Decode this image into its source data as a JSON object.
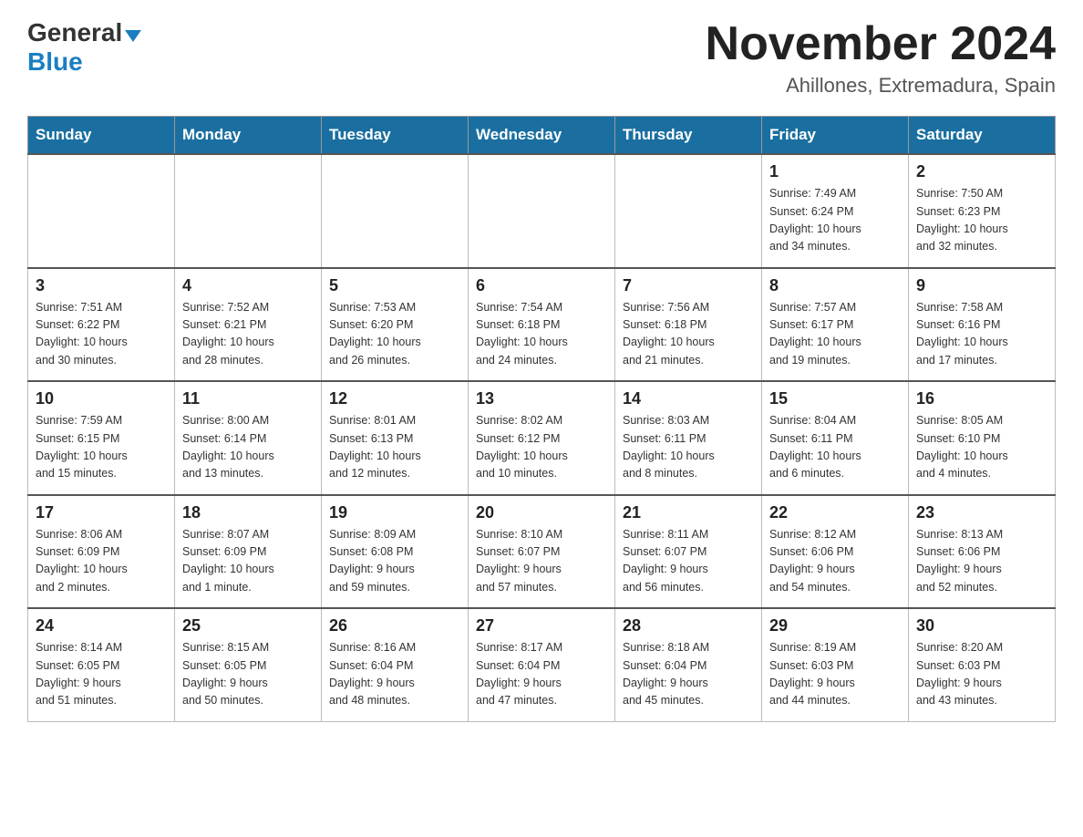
{
  "logo": {
    "general": "General",
    "blue": "Blue",
    "triangle": "▼"
  },
  "title": "November 2024",
  "location": "Ahillones, Extremadura, Spain",
  "days_of_week": [
    "Sunday",
    "Monday",
    "Tuesday",
    "Wednesday",
    "Thursday",
    "Friday",
    "Saturday"
  ],
  "weeks": [
    {
      "days": [
        {
          "number": "",
          "info": "",
          "empty": true
        },
        {
          "number": "",
          "info": "",
          "empty": true
        },
        {
          "number": "",
          "info": "",
          "empty": true
        },
        {
          "number": "",
          "info": "",
          "empty": true
        },
        {
          "number": "",
          "info": "",
          "empty": true
        },
        {
          "number": "1",
          "info": "Sunrise: 7:49 AM\nSunset: 6:24 PM\nDaylight: 10 hours\nand 34 minutes."
        },
        {
          "number": "2",
          "info": "Sunrise: 7:50 AM\nSunset: 6:23 PM\nDaylight: 10 hours\nand 32 minutes."
        }
      ]
    },
    {
      "days": [
        {
          "number": "3",
          "info": "Sunrise: 7:51 AM\nSunset: 6:22 PM\nDaylight: 10 hours\nand 30 minutes."
        },
        {
          "number": "4",
          "info": "Sunrise: 7:52 AM\nSunset: 6:21 PM\nDaylight: 10 hours\nand 28 minutes."
        },
        {
          "number": "5",
          "info": "Sunrise: 7:53 AM\nSunset: 6:20 PM\nDaylight: 10 hours\nand 26 minutes."
        },
        {
          "number": "6",
          "info": "Sunrise: 7:54 AM\nSunset: 6:18 PM\nDaylight: 10 hours\nand 24 minutes."
        },
        {
          "number": "7",
          "info": "Sunrise: 7:56 AM\nSunset: 6:18 PM\nDaylight: 10 hours\nand 21 minutes."
        },
        {
          "number": "8",
          "info": "Sunrise: 7:57 AM\nSunset: 6:17 PM\nDaylight: 10 hours\nand 19 minutes."
        },
        {
          "number": "9",
          "info": "Sunrise: 7:58 AM\nSunset: 6:16 PM\nDaylight: 10 hours\nand 17 minutes."
        }
      ]
    },
    {
      "days": [
        {
          "number": "10",
          "info": "Sunrise: 7:59 AM\nSunset: 6:15 PM\nDaylight: 10 hours\nand 15 minutes."
        },
        {
          "number": "11",
          "info": "Sunrise: 8:00 AM\nSunset: 6:14 PM\nDaylight: 10 hours\nand 13 minutes."
        },
        {
          "number": "12",
          "info": "Sunrise: 8:01 AM\nSunset: 6:13 PM\nDaylight: 10 hours\nand 12 minutes."
        },
        {
          "number": "13",
          "info": "Sunrise: 8:02 AM\nSunset: 6:12 PM\nDaylight: 10 hours\nand 10 minutes."
        },
        {
          "number": "14",
          "info": "Sunrise: 8:03 AM\nSunset: 6:11 PM\nDaylight: 10 hours\nand 8 minutes."
        },
        {
          "number": "15",
          "info": "Sunrise: 8:04 AM\nSunset: 6:11 PM\nDaylight: 10 hours\nand 6 minutes."
        },
        {
          "number": "16",
          "info": "Sunrise: 8:05 AM\nSunset: 6:10 PM\nDaylight: 10 hours\nand 4 minutes."
        }
      ]
    },
    {
      "days": [
        {
          "number": "17",
          "info": "Sunrise: 8:06 AM\nSunset: 6:09 PM\nDaylight: 10 hours\nand 2 minutes."
        },
        {
          "number": "18",
          "info": "Sunrise: 8:07 AM\nSunset: 6:09 PM\nDaylight: 10 hours\nand 1 minute."
        },
        {
          "number": "19",
          "info": "Sunrise: 8:09 AM\nSunset: 6:08 PM\nDaylight: 9 hours\nand 59 minutes."
        },
        {
          "number": "20",
          "info": "Sunrise: 8:10 AM\nSunset: 6:07 PM\nDaylight: 9 hours\nand 57 minutes."
        },
        {
          "number": "21",
          "info": "Sunrise: 8:11 AM\nSunset: 6:07 PM\nDaylight: 9 hours\nand 56 minutes."
        },
        {
          "number": "22",
          "info": "Sunrise: 8:12 AM\nSunset: 6:06 PM\nDaylight: 9 hours\nand 54 minutes."
        },
        {
          "number": "23",
          "info": "Sunrise: 8:13 AM\nSunset: 6:06 PM\nDaylight: 9 hours\nand 52 minutes."
        }
      ]
    },
    {
      "days": [
        {
          "number": "24",
          "info": "Sunrise: 8:14 AM\nSunset: 6:05 PM\nDaylight: 9 hours\nand 51 minutes."
        },
        {
          "number": "25",
          "info": "Sunrise: 8:15 AM\nSunset: 6:05 PM\nDaylight: 9 hours\nand 50 minutes."
        },
        {
          "number": "26",
          "info": "Sunrise: 8:16 AM\nSunset: 6:04 PM\nDaylight: 9 hours\nand 48 minutes."
        },
        {
          "number": "27",
          "info": "Sunrise: 8:17 AM\nSunset: 6:04 PM\nDaylight: 9 hours\nand 47 minutes."
        },
        {
          "number": "28",
          "info": "Sunrise: 8:18 AM\nSunset: 6:04 PM\nDaylight: 9 hours\nand 45 minutes."
        },
        {
          "number": "29",
          "info": "Sunrise: 8:19 AM\nSunset: 6:03 PM\nDaylight: 9 hours\nand 44 minutes."
        },
        {
          "number": "30",
          "info": "Sunrise: 8:20 AM\nSunset: 6:03 PM\nDaylight: 9 hours\nand 43 minutes."
        }
      ]
    }
  ]
}
